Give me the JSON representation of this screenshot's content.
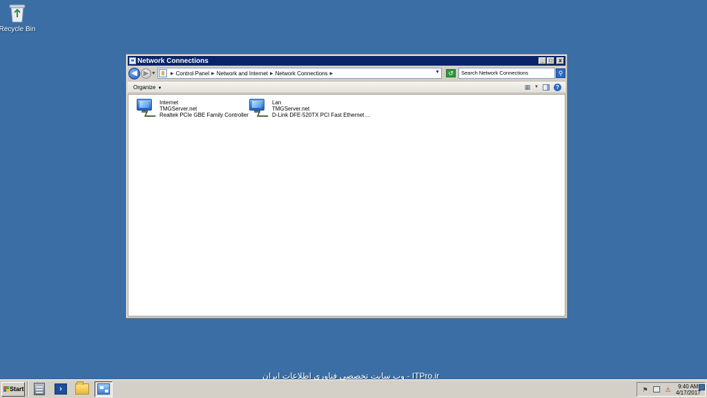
{
  "desktop": {
    "icons": [
      {
        "label": "Recycle Bin",
        "icon": "recycle-bin-icon"
      }
    ]
  },
  "window": {
    "title": "Network Connections",
    "controls": {
      "minimize": "_",
      "maximize": "□",
      "close": "x"
    },
    "address": {
      "breadcrumbs": [
        "Control Panel",
        "Network and Internet",
        "Network Connections"
      ]
    },
    "search": {
      "placeholder": "Search Network Connections"
    },
    "toolbar": {
      "organize_label": "Organize"
    },
    "connections": [
      {
        "name": "Internet",
        "domain": "TMGServer.net",
        "adapter": "Realtek PCIe GBE Family Controller"
      },
      {
        "name": "Lan",
        "domain": "TMGServer.net",
        "adapter": "D-Link DFE-520TX PCI Fast Ethernet ..."
      }
    ]
  },
  "taskbar": {
    "start_label": "Start",
    "quick_launch": [
      "server-manager-icon",
      "powershell-icon",
      "windows-explorer-icon",
      "network-connections-icon"
    ],
    "watermark": "ITPro.ir - وب سایت تخصصی فناوری اطلاعات ایران",
    "clock": {
      "time": "9:40 AM",
      "date": "4/17/2017"
    }
  },
  "colors": {
    "desktop_bg": "#3a6ea5",
    "titlebar_bg": "#0a246a",
    "chrome_bg": "#d4d0c8"
  }
}
